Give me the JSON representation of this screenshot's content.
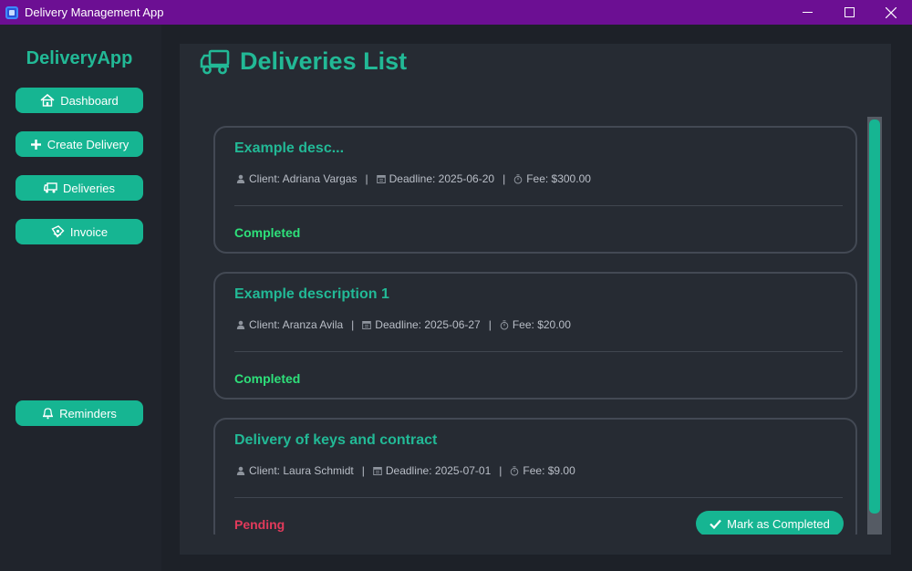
{
  "window": {
    "title": "Delivery Management App",
    "minimize_glyph": "—",
    "maximize_glyph": "☐",
    "close_glyph": "✕"
  },
  "sidebar": {
    "brand": "DeliveryApp",
    "items": [
      {
        "label": "Dashboard",
        "icon": "home-icon"
      },
      {
        "label": "Create Delivery",
        "icon": "plus-icon"
      },
      {
        "label": "Deliveries",
        "icon": "truck-icon"
      },
      {
        "label": "Invoice",
        "icon": "invoice-icon"
      },
      {
        "label": "Reminders",
        "icon": "bell-icon"
      }
    ]
  },
  "main": {
    "title": "Deliveries List",
    "title_icon": "truck-icon",
    "deliveries": [
      {
        "description": "Example desc...",
        "client": "Client: Adriana Vargas",
        "deadline": "Deadline: 2025-06-20",
        "fee": "Fee: $300.00",
        "status": "Completed"
      },
      {
        "description": "Example description 1",
        "client": "Client: Aranza Avila",
        "deadline": "Deadline: 2025-06-27",
        "fee": "Fee: $20.00",
        "status": "Completed"
      },
      {
        "description": "Delivery of keys and contract",
        "client": "Client: Laura Schmidt",
        "deadline": "Deadline: 2025-07-01",
        "fee": "Fee: $9.00",
        "status": "Pending",
        "action_label": "Mark as Completed"
      }
    ],
    "separator": "|"
  },
  "colors": {
    "accent": "#16b592",
    "title_bar": "#6c0f93",
    "completed": "#2ee07a",
    "pending": "#e23a5b"
  }
}
